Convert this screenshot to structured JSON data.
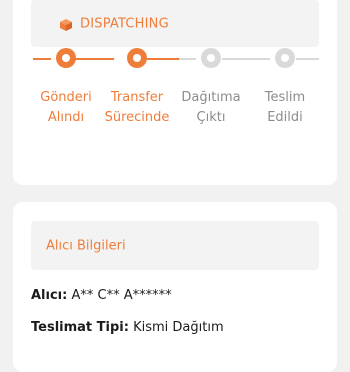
{
  "status": {
    "icon": "box-icon",
    "label": "DISPATCHING",
    "accent_color": "#ef7d3a"
  },
  "tracker": {
    "active_color": "#ef7d3a",
    "inactive_color": "#d9d9d9",
    "steps": [
      {
        "line1": "Gönderi",
        "line2": "Alındı",
        "active": true
      },
      {
        "line1": "Transfer",
        "line2": "Sürecinde",
        "active": true
      },
      {
        "line1": "Dağıtıma",
        "line2": "Çıktı",
        "active": false
      },
      {
        "line1": "Teslim",
        "line2": "Edildi",
        "active": false
      }
    ]
  },
  "recipient": {
    "title": "Alıcı Bilgileri",
    "fields": [
      {
        "label": "Alıcı:",
        "value": "A** C** A******"
      },
      {
        "label": "Teslimat Tipi:",
        "value": "Kismi Dağıtım"
      }
    ]
  }
}
